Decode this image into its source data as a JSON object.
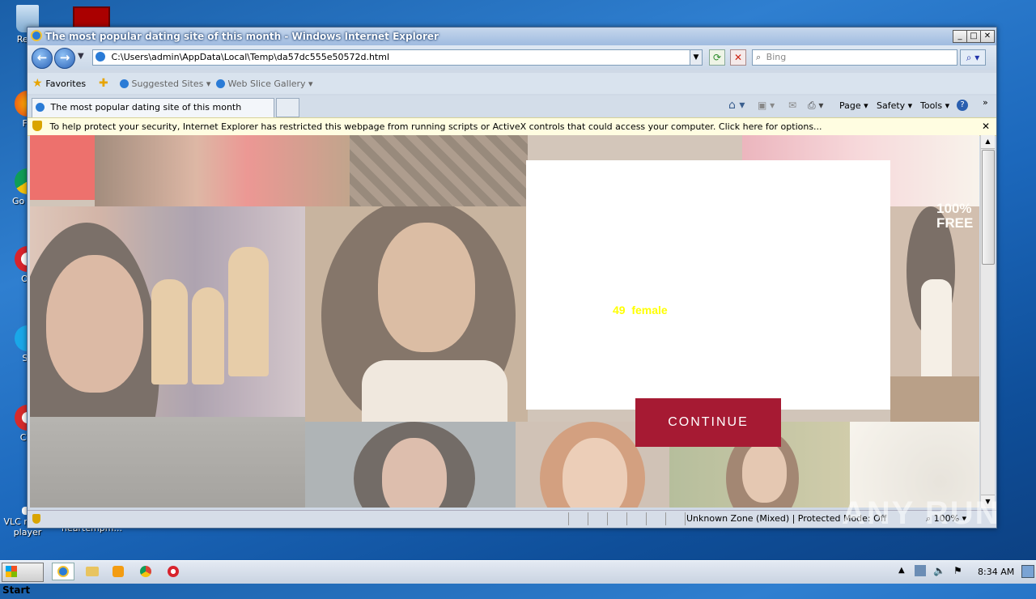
{
  "desktop": {
    "icons": [
      {
        "label": "Recy",
        "name": "recycle-bin-icon"
      },
      {
        "label": "Fir",
        "name": "firefox-icon"
      },
      {
        "label": "Go Chr",
        "name": "chrome-icon"
      },
      {
        "label": "Op",
        "name": "opera-icon"
      },
      {
        "label": "Sk",
        "name": "skype-icon"
      },
      {
        "label": "CCl",
        "name": "ccleaner-icon"
      },
      {
        "label": "VLC media player",
        "name": "vlc-icon"
      }
    ],
    "partial_label": "heartempm..."
  },
  "window": {
    "title": "The most popular dating site of this month - Windows Internet Explorer",
    "address": "C:\\Users\\admin\\AppData\\Local\\Temp\\da57dc555e50572d.html",
    "search_placeholder": "Bing",
    "favorites_label": "Favorites",
    "suggested_sites": "Suggested Sites",
    "web_slice_gallery": "Web Slice Gallery",
    "tab_title": "The most popular dating site of this month",
    "toolbar": {
      "page": "Page",
      "safety": "Safety",
      "tools": "Tools"
    },
    "infobar_text": "To help protect your security, Internet Explorer has restricted this webpage from running scripts or ActiveX controls that could access your computer. Click here for options...",
    "status_zone": "Unknown Zone (Mixed) | Protected Mode: Off",
    "zoom": "100%"
  },
  "page": {
    "modal_text": "49  female",
    "continue_label": "CONTINUE",
    "badge_line1": "100%",
    "badge_line2": "FREE"
  },
  "watermark": "ANY RUN",
  "taskbar": {
    "start_label": "Start",
    "clock": "8:34 AM"
  },
  "colors": {
    "continue_bg": "#a61a33",
    "modal_text": "#ffff00",
    "red_block": "#e31d1d"
  }
}
